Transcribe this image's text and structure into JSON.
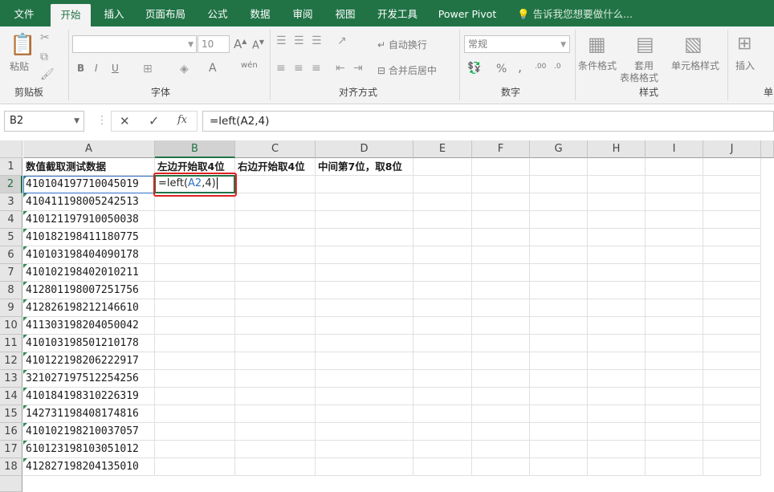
{
  "tabs": [
    "文件",
    "开始",
    "插入",
    "页面布局",
    "公式",
    "数据",
    "审阅",
    "视图",
    "开发工具",
    "Power Pivot"
  ],
  "active_tab": "开始",
  "tell_me": "告诉我您想要做什么...",
  "ribbon": {
    "clipboard": {
      "label": "剪贴板",
      "paste": "粘贴"
    },
    "font": {
      "label": "字体",
      "size": "10",
      "bold": "B",
      "italic": "I",
      "underline": "U",
      "wen": "wén"
    },
    "alignment": {
      "label": "对齐方式",
      "wrap": "自动换行",
      "merge": "合并后居中"
    },
    "number": {
      "label": "数字",
      "format": "常规",
      "percent": "%",
      "comma": ","
    },
    "styles": {
      "label": "样式",
      "conditional": "条件格式",
      "table_l1": "套用",
      "table_l2": "表格格式",
      "cell_styles": "单元格样式"
    },
    "cells": {
      "insert": "插入",
      "label_partial": "单"
    }
  },
  "formula_bar": {
    "name_box": "B2",
    "formula": "=left(A2,4)",
    "cancel": "✕",
    "enter": "✓",
    "fx": "fx"
  },
  "columns": [
    "A",
    "B",
    "C",
    "D",
    "E",
    "F",
    "G",
    "H",
    "I",
    "J"
  ],
  "rows": [
    "1",
    "2",
    "3",
    "4",
    "5",
    "6",
    "7",
    "8",
    "9",
    "10",
    "11",
    "12",
    "13",
    "14",
    "15",
    "16",
    "17",
    "18"
  ],
  "headers": {
    "A1": "数值截取测试数据",
    "B1": "左边开始取4位",
    "C1": "右边开始取4位",
    "D1": "中间第7位，取8位"
  },
  "data": [
    "410104197710045019",
    "410411198005242513",
    "410121197910050038",
    "410182198411180775",
    "410103198404090178",
    "410102198402010211",
    "412801198007251756",
    "412826198212146610",
    "411303198204050042",
    "410103198501210178",
    "410122198206222917",
    "321027197512254256",
    "410184198310226319",
    "142731198408174816",
    "410102198210037057",
    "610123198103051012",
    "412827198204135010"
  ],
  "editing": {
    "pre": "=left(",
    "ref": "A2",
    "post": ",4)"
  }
}
